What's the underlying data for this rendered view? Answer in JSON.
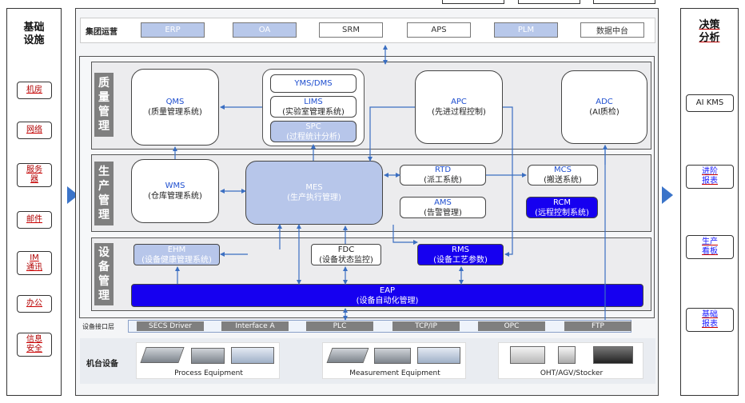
{
  "left_panel": {
    "title": "基础\n设施",
    "items": [
      "机房",
      "网络",
      "服务\n器",
      "邮件",
      "IM\n通讯",
      "办公",
      "信息\n安全"
    ]
  },
  "right_panel": {
    "title": "决策\n分析",
    "items": [
      "AI KMS",
      "进阶\n报表",
      "生产\n看板",
      "基础\n报表"
    ]
  },
  "group_ops": {
    "label": "集团运营",
    "systems": [
      "ERP",
      "OA",
      "SRM",
      "APS",
      "PLM",
      "数据中台"
    ]
  },
  "quality": {
    "label": "质\n量\n管\n理",
    "qms": {
      "name": "QMS",
      "desc": "(质量管理系统)"
    },
    "yms": "YMS/DMS",
    "lims": {
      "name": "LIMS",
      "desc": "(实验室管理系统)"
    },
    "spc": {
      "name": "SPC",
      "desc": "(过程统计分析)"
    },
    "apc": {
      "name": "APC",
      "desc": "(先进过程控制)"
    },
    "adc": {
      "name": "ADC",
      "desc": "(AI质检)"
    }
  },
  "production": {
    "label": "生\n产\n管\n理",
    "wms": {
      "name": "WMS",
      "desc": "(仓库管理系统)"
    },
    "mes": {
      "name": "MES",
      "desc": "(生产执行管理)"
    },
    "rtd": {
      "name": "RTD",
      "desc": "(派工系统)"
    },
    "ams": {
      "name": "AMS",
      "desc": "(告警管理)"
    },
    "mcs": {
      "name": "MCS",
      "desc": "(搬送系统)"
    },
    "rcm": {
      "name": "RCM",
      "desc": "(远程控制系统)"
    }
  },
  "equipment": {
    "label": "设\n备\n管\n理",
    "ehm": {
      "name": "EHM",
      "desc": "(设备健康管理系统)"
    },
    "fdc": {
      "name": "FDC",
      "desc": "(设备状态监控)"
    },
    "rms": {
      "name": "RMS",
      "desc": "(设备工艺参数)"
    },
    "eap": {
      "name": "EAP",
      "desc": "(设备自动化管理)"
    }
  },
  "interface_layer": {
    "label": "设备接口层",
    "items": [
      "SECS Driver",
      "Interface A",
      "PLC",
      "TCP/IP",
      "OPC",
      "FTP"
    ]
  },
  "machines": {
    "label": "机台设备",
    "groups": [
      "Process Equipment",
      "Measurement Equipment",
      "OHT/AGV/Stocker"
    ]
  },
  "colors": {
    "accent_blue": "#1600f0",
    "light_blue": "#b7c6ea",
    "arrow_blue": "#3b74c9",
    "gray_label": "#7f7f7f"
  }
}
